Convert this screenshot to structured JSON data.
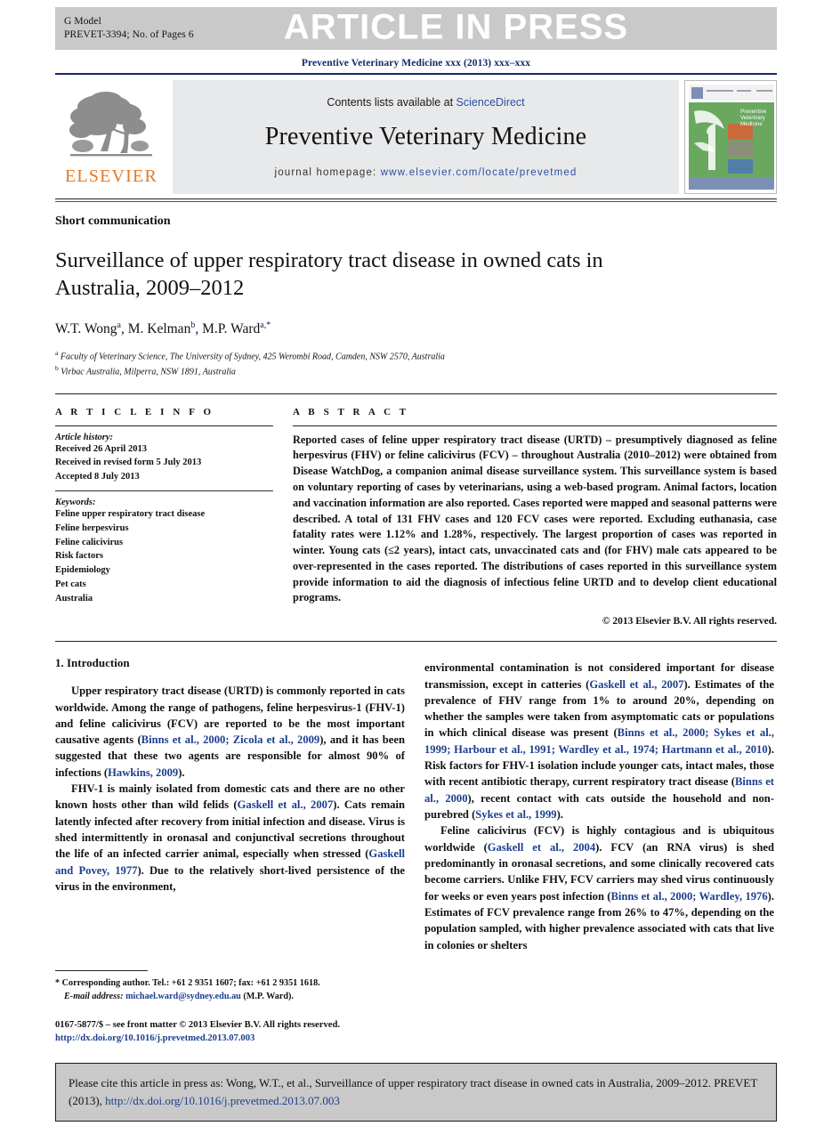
{
  "banner": {
    "gmodel_line1": "G Model",
    "gmodel_line2": "PREVET-3394;   No. of Pages 6",
    "title": "ARTICLE IN PRESS"
  },
  "running_head": "Preventive Veterinary Medicine xxx (2013) xxx–xxx",
  "masthead": {
    "publisher_word": "ELSEVIER",
    "contents_prefix": "Contents lists available at ",
    "sciencedirect": "ScienceDirect",
    "journal_name": "Preventive Veterinary Medicine",
    "homepage_label": "journal homepage: ",
    "homepage_url": "www.elsevier.com/locate/prevetmed",
    "cover_title": "Preventive Veterinary Medicine"
  },
  "article": {
    "kicker": "Short communication",
    "title": "Surveillance of upper respiratory tract disease in owned cats in Australia, 2009–2012",
    "authors_html": "W.T. Wong<sup>a</sup>, M. Kelman<sup>b</sup>, M.P. Ward<sup>a,*</sup>",
    "affiliation_a": "Faculty of Veterinary Science, The University of Sydney, 425 Werombi Road, Camden, NSW 2570, Australia",
    "affiliation_b": "Virbac Australia, Milperra, NSW 1891, Australia"
  },
  "info": {
    "heading": "A R T I C L E   I N F O",
    "history_label": "Article history:",
    "history": [
      "Received 26 April 2013",
      "Received in revised form 5 July 2013",
      "Accepted 8 July 2013"
    ],
    "keywords_label": "Keywords:",
    "keywords": [
      "Feline upper respiratory tract disease",
      "Feline herpesvirus",
      "Feline calicivirus",
      "Risk factors",
      "Epidemiology",
      "Pet cats",
      "Australia"
    ]
  },
  "abstract": {
    "heading": "A B S T R A C T",
    "body": "Reported cases of feline upper respiratory tract disease (URTD) – presumptively diagnosed as feline herpesvirus (FHV) or feline calicivirus (FCV) – throughout Australia (2010–2012) were obtained from Disease WatchDog, a companion animal disease surveillance system. This surveillance system is based on voluntary reporting of cases by veterinarians, using a web-based program. Animal factors, location and vaccination information are also reported. Cases reported were mapped and seasonal patterns were described. A total of 131 FHV cases and 120 FCV cases were reported. Excluding euthanasia, case fatality rates were 1.12% and 1.28%, respectively. The largest proportion of cases was reported in winter. Young cats (≤2 years), intact cats, unvaccinated cats and (for FHV) male cats appeared to be over-represented in the cases reported. The distributions of cases reported in this surveillance system provide information to aid the diagnosis of infectious feline URTD and to develop client educational programs.",
    "copyright": "© 2013 Elsevier B.V. All rights reserved."
  },
  "body": {
    "section_heading": "1.  Introduction",
    "left_paragraphs": [
      {
        "parts": [
          {
            "t": "Upper respiratory tract disease (URTD) is commonly reported in cats worldwide. Among the range of pathogens, feline herpesvirus-1 (FHV-1) and feline calicivirus (FCV) are reported to be the most important causative agents (",
            "c": false
          },
          {
            "t": "Binns et al., 2000; Zicola et al., 2009",
            "c": true
          },
          {
            "t": "), and it has been suggested that these two agents are responsible for almost 90% of infections (",
            "c": false
          },
          {
            "t": "Hawkins, 2009",
            "c": true
          },
          {
            "t": ").",
            "c": false
          }
        ]
      },
      {
        "parts": [
          {
            "t": "FHV-1 is mainly isolated from domestic cats and there are no other known hosts other than wild felids (",
            "c": false
          },
          {
            "t": "Gaskell et al., 2007",
            "c": true
          },
          {
            "t": "). Cats remain latently infected after recovery from initial infection and disease. Virus is shed intermittently in oronasal and conjunctival secretions throughout the life of an infected carrier animal, especially when stressed (",
            "c": false
          },
          {
            "t": "Gaskell and Povey, 1977",
            "c": true
          },
          {
            "t": "). Due to the relatively short-lived persistence of the virus in the environment,",
            "c": false
          }
        ]
      }
    ],
    "right_paragraphs": [
      {
        "indent": false,
        "parts": [
          {
            "t": "environmental contamination is not considered important for disease transmission, except in catteries (",
            "c": false
          },
          {
            "t": "Gaskell et al., 2007",
            "c": true
          },
          {
            "t": "). Estimates of the prevalence of FHV range from 1% to around 20%, depending on whether the samples were taken from asymptomatic cats or populations in which clinical disease was present (",
            "c": false
          },
          {
            "t": "Binns et al., 2000; Sykes et al., 1999; Harbour et al., 1991; Wardley et al., 1974; Hartmann et al., 2010",
            "c": true
          },
          {
            "t": "). Risk factors for FHV-1 isolation include younger cats, intact males, those with recent antibiotic therapy, current respiratory tract disease (",
            "c": false
          },
          {
            "t": "Binns et al., 2000",
            "c": true
          },
          {
            "t": "), recent contact with cats outside the household and non-purebred (",
            "c": false
          },
          {
            "t": "Sykes et al., 1999",
            "c": true
          },
          {
            "t": ").",
            "c": false
          }
        ]
      },
      {
        "indent": true,
        "parts": [
          {
            "t": "Feline calicivirus (FCV) is highly contagious and is ubiquitous worldwide (",
            "c": false
          },
          {
            "t": "Gaskell et al., 2004",
            "c": true
          },
          {
            "t": "). FCV (an RNA virus) is shed predominantly in oronasal secretions, and some clinically recovered cats become carriers. Unlike FHV, FCV carriers may shed virus continuously for weeks or even years post infection (",
            "c": false
          },
          {
            "t": "Binns et al., 2000; Wardley, 1976",
            "c": true
          },
          {
            "t": "). Estimates of FCV prevalence range from 26% to 47%, depending on the population sampled, with higher prevalence associated with cats that live in colonies or shelters",
            "c": false
          }
        ]
      }
    ]
  },
  "footnote": {
    "corresponding": "*  Corresponding author. Tel.: +61 2 9351 1607; fax: +61 2 9351 1618.",
    "email_label": "E-mail address:",
    "email": "michael.ward@sydney.edu.au",
    "email_suffix": "(M.P. Ward).",
    "issn_line": "0167-5877/$ – see front matter © 2013 Elsevier B.V. All rights reserved.",
    "doi_url": "http://dx.doi.org/10.1016/j.prevetmed.2013.07.003"
  },
  "citebox": {
    "prefix": "Please cite this article in press as: Wong, W.T., et al., Surveillance of upper respiratory tract disease in owned cats in Australia, 2009–2012. PREVET (2013), ",
    "doi": "http://dx.doi.org/10.1016/j.prevetmed.2013.07.003"
  },
  "colors": {
    "banner_bg": "#c9c9c9",
    "navy": "#14296b",
    "link": "#1d3e8f",
    "elsevier_orange": "#e87722",
    "journal_box_bg": "#e8e9eb"
  }
}
